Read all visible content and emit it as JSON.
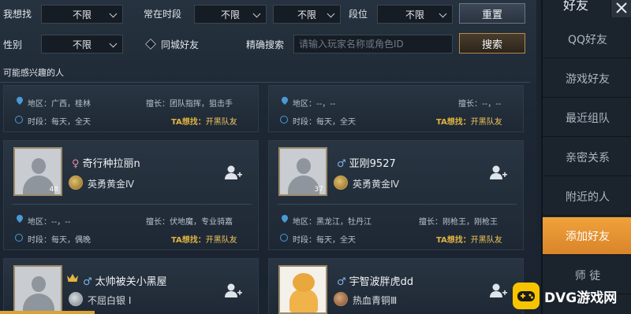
{
  "filters": {
    "want_find_label": "我想找",
    "want_find_value": "不限",
    "active_time_label": "常在时段",
    "active_time_value_1": "不限",
    "active_time_value_2": "不限",
    "rank_label": "段位",
    "rank_value": "不限",
    "reset_label": "重置",
    "gender_label": "性别",
    "gender_value": "不限",
    "same_city_label": "同城好友",
    "exact_search_label": "精确搜索",
    "search_placeholder": "请输入玩家名称或角色ID",
    "search_button_label": "搜索"
  },
  "section_title": "可能感兴趣的人",
  "top_cards": [
    {
      "region": "地区：广西，桂林",
      "time": "时段：每天，全天",
      "skill": "擅长：团队指挥，狙击手",
      "ta_label": "TA想找：",
      "ta_value": "开黑队友"
    },
    {
      "region": "地区：--，--",
      "time": "时段：每天，全天",
      "skill": "擅长：--，--",
      "ta_label": "TA想找：",
      "ta_value": "开黑队友"
    }
  ],
  "players": [
    {
      "name": "奇行种拉丽n",
      "gender": "♀",
      "level": "48",
      "rank": "英勇黄金Ⅳ",
      "region": "地区：--，--",
      "time": "时段：每天，偶晚",
      "skill": "擅长：伏地魔，专业骑嘉",
      "ta_label": "TA想找：",
      "ta_value": "开黑队友"
    },
    {
      "name": "亚刚9527",
      "gender": "♂",
      "level": "37",
      "rank": "英勇黄金Ⅳ",
      "region": "地区：黑龙江，牡丹江",
      "time": "时段：每天，全天",
      "skill": "擅长：刚枪王，刚枪王",
      "ta_label": "TA想找：",
      "ta_value": "开黑队友"
    },
    {
      "name": "太帅被关小黑屋",
      "gender": "♂",
      "level": "",
      "rank": "不屈白银 Ⅰ"
    },
    {
      "name": "宇智波胖虎dd",
      "gender": "♂",
      "level": "",
      "rank": "热血青铜Ⅲ"
    }
  ],
  "sidebar": {
    "title": "好友",
    "items": [
      "QQ好友",
      "游戏好友",
      "最近组队",
      "亲密关系",
      "附近的人",
      "添加好友",
      "师 徒"
    ]
  },
  "watermark": "DVG游戏网",
  "colors": {
    "accent": "#e0a03a",
    "ta": "#f1c55c",
    "gender_male": "#7db3e8",
    "gender_female": "#e58aa8"
  }
}
